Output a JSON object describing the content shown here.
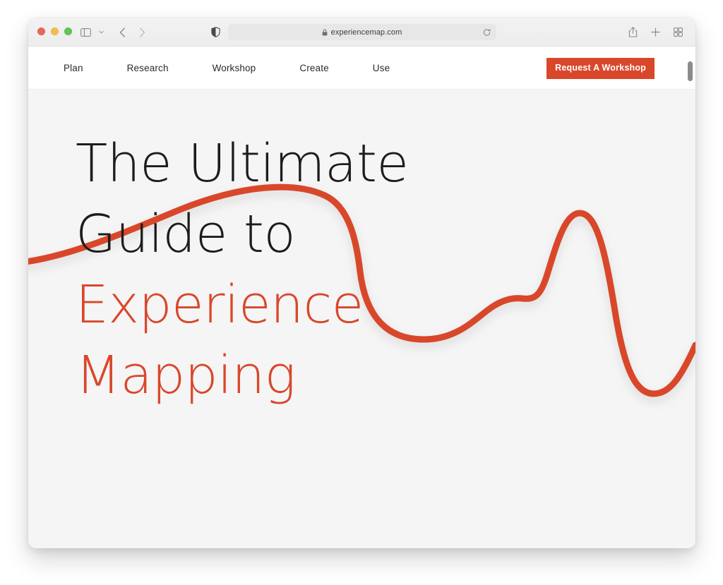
{
  "browser": {
    "traffic_lights": [
      "close",
      "minimize",
      "maximize"
    ],
    "toolbar": {
      "sidebar_toggle": "sidebar-icon",
      "tab_group_caret": "chevron-down-icon",
      "back": "back-arrow-icon",
      "forward": "forward-arrow-icon",
      "privacy_report": "shield-icon",
      "reader_view": "reader-icon",
      "page_settings": "page-settings-icon",
      "share": "share-icon",
      "new_tab": "plus-icon",
      "tab_overview": "tab-overview-icon"
    },
    "address_bar": {
      "lock": "lock-icon",
      "url": "experiencemap.com",
      "reload": "reload-icon"
    }
  },
  "site": {
    "nav": {
      "items": [
        {
          "label": "Plan"
        },
        {
          "label": "Research"
        },
        {
          "label": "Workshop"
        },
        {
          "label": "Create"
        },
        {
          "label": "Use"
        }
      ],
      "cta": {
        "label": "Request A Workshop",
        "background": "#d9472b",
        "text_color": "#ffffff"
      }
    },
    "hero": {
      "headline_lines": [
        {
          "text": "The Ultimate",
          "color": "#1c1c1c"
        },
        {
          "text": "Guide to",
          "color": "#1c1c1c"
        },
        {
          "text": "Experience",
          "color": "#d9472b"
        },
        {
          "text": "Mapping",
          "color": "#d9472b"
        }
      ],
      "background": "#f5f5f5",
      "wave_color": "#d9472b",
      "wave_description": "experience-map-curve"
    },
    "scrollbar": {
      "thumb_color": "#8b8b8b"
    }
  }
}
